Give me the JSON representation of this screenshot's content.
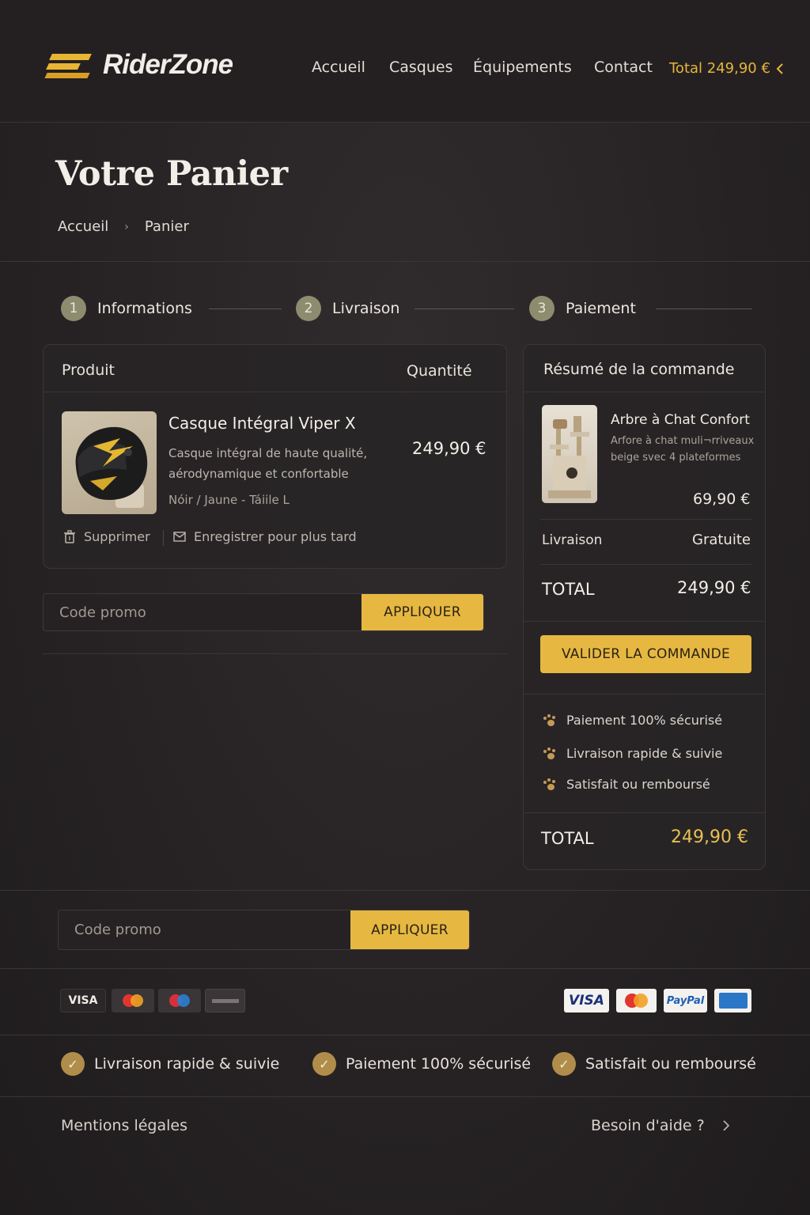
{
  "header": {
    "brand": "RiderZone",
    "nav": [
      "Accueil",
      "Casques",
      "Équipements",
      "Contact"
    ],
    "cart_total": "Total 249,90 €"
  },
  "page": {
    "title": "Votre Panier",
    "breadcrumb": [
      "Accueil",
      "Panier"
    ]
  },
  "steps": [
    {
      "num": "1",
      "label": "Informations"
    },
    {
      "num": "2",
      "label": "Livraison"
    },
    {
      "num": "3",
      "label": "Paiement"
    }
  ],
  "cart": {
    "col_product": "Produit",
    "col_quantity": "Quantité",
    "item": {
      "name": "Casque Intégral Viper X",
      "description": "Casque intégral de haute qualité, aérodynamique et confortable",
      "variant": "Nóir / Jaune - Táiile L",
      "price": "249,90 €",
      "image_icon": "helmet-image"
    },
    "delete_label": "Supprimer",
    "save_label": "Enregistrer pour plus tard"
  },
  "promo": {
    "placeholder": "Code promo",
    "button": "APPLIQUER"
  },
  "summary": {
    "title": "Résumé de la commande",
    "item_name": "Arbre à Chat Confort",
    "item_desc_1": "Arfore à chat muli¬rriveaux",
    "item_desc_2": "beige svec 4 plateformes",
    "item_price": "69,90 €",
    "shipping_label": "Livraison",
    "shipping_value": "Gratuite",
    "total_label": "TOTAL",
    "total_value": "249,90 €",
    "cta": "VALIDER LA COMMANDE",
    "features": [
      "Paiement 100% sécurisé",
      "Livraison rapide & suivie",
      "Satisfait ou remboursé"
    ],
    "footer_total_label": "TOTAL",
    "footer_total_value": "249,90 €"
  },
  "payments_left": [
    "VISA",
    "mastercard",
    "maestro",
    "card"
  ],
  "payments_right": [
    "VISA",
    "mastercard",
    "PayPal",
    "amex"
  ],
  "assurances": [
    "Livraison rapide & suivie",
    "Paiement 100% sécurisé",
    "Satisfait ou remboursé"
  ],
  "footer": {
    "legal": "Mentions légales",
    "help": "Besoin d'aide ?"
  },
  "colors": {
    "accent": "#e6b842",
    "background": "#272325",
    "step_badge": "#8d8c6e"
  }
}
